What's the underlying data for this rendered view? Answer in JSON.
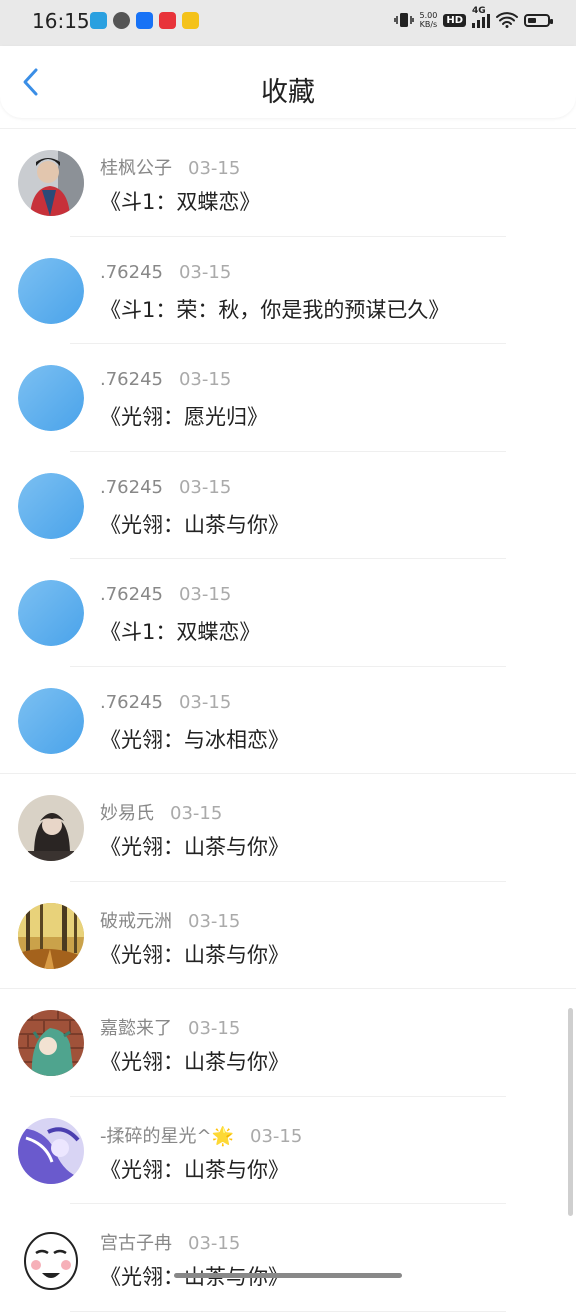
{
  "status_bar": {
    "time": "16:15",
    "net_speed_value": "5.00",
    "net_speed_unit": "KB/s",
    "hd_label": "HD",
    "network_label": "4G",
    "battery_level": 0.45
  },
  "header": {
    "title": "收藏",
    "back_icon": "chevron-left-icon",
    "accent_color": "#3a8ee6"
  },
  "items": [
    {
      "name": "桂枫公子",
      "date": "03-15",
      "title": "《斗1：双蝶恋》",
      "avatar": "photo-person-red"
    },
    {
      "name": ".76245",
      "date": "03-15",
      "title": "《斗1：荣：秋，你是我的预谋已久》",
      "avatar": "default-blue"
    },
    {
      "name": ".76245",
      "date": "03-15",
      "title": "《光翎：愿光归》",
      "avatar": "default-blue"
    },
    {
      "name": ".76245",
      "date": "03-15",
      "title": "《光翎：山茶与你》",
      "avatar": "default-blue"
    },
    {
      "name": ".76245",
      "date": "03-15",
      "title": "《斗1：双蝶恋》",
      "avatar": "default-blue"
    },
    {
      "name": ".76245",
      "date": "03-15",
      "title": "《光翎：与冰相恋》",
      "avatar": "default-blue"
    },
    {
      "name": "妙易氏",
      "date": "03-15",
      "title": "《光翎：山茶与你》",
      "avatar": "photo-girl"
    },
    {
      "name": "破戒元洲",
      "date": "03-15",
      "title": "《光翎：山茶与你》",
      "avatar": "photo-forest"
    },
    {
      "name": "嘉懿来了",
      "date": "03-15",
      "title": "《光翎：山茶与你》",
      "avatar": "illustration-dino-hoodie"
    },
    {
      "name": "-揉碎的星光^🌟",
      "date": "03-15",
      "title": "《光翎：山茶与你》",
      "avatar": "illustration-purple"
    },
    {
      "name": "宫古子冉",
      "date": "03-15",
      "title": "《光翎：山茶与你》",
      "avatar": "meme-face"
    }
  ]
}
